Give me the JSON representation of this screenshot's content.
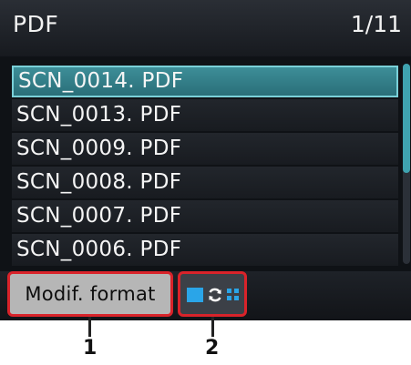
{
  "header": {
    "title": "PDF",
    "page_count": "1/11"
  },
  "file_list": {
    "items": [
      {
        "label": "SCN_0014. PDF",
        "selected": true
      },
      {
        "label": "SCN_0013. PDF",
        "selected": false
      },
      {
        "label": "SCN_0009. PDF",
        "selected": false
      },
      {
        "label": "SCN_0008. PDF",
        "selected": false
      },
      {
        "label": "SCN_0007. PDF",
        "selected": false
      },
      {
        "label": "SCN_0006. PDF",
        "selected": false
      }
    ]
  },
  "footer": {
    "format_button_label": "Modif. format",
    "view_toggle_icon": "single-cycle-grid-view-icon"
  },
  "callouts": {
    "one": "1",
    "two": "2"
  },
  "colors": {
    "selection": "#3d8e98",
    "callout_border": "#d9232a",
    "view_icon": "#2aa5e8"
  }
}
